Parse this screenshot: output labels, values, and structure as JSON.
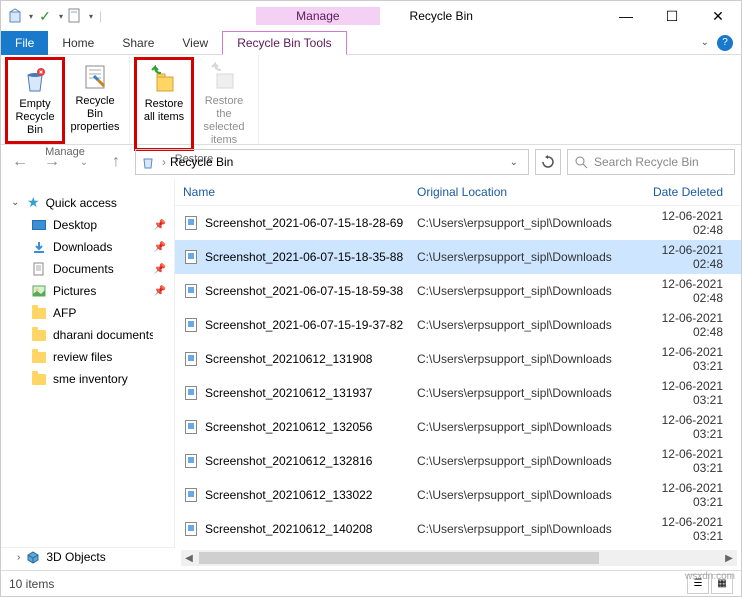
{
  "window": {
    "title": "Recycle Bin",
    "context_tab_group": "Manage",
    "context_tab": "Recycle Bin Tools"
  },
  "tabs": {
    "file": "File",
    "home": "Home",
    "share": "Share",
    "view": "View"
  },
  "ribbon": {
    "empty": "Empty Recycle Bin",
    "props": "Recycle Bin properties",
    "restore_all": "Restore all items",
    "restore_sel": "Restore the selected items",
    "group_manage": "Manage",
    "group_restore": "Restore"
  },
  "address": {
    "location": "Recycle Bin",
    "search_placeholder": "Search Recycle Bin"
  },
  "nav": {
    "quick_access": "Quick access",
    "desktop": "Desktop",
    "downloads": "Downloads",
    "documents": "Documents",
    "pictures": "Pictures",
    "afp": "AFP",
    "dharani": "dharani documents",
    "review": "review files",
    "sme": "sme inventory",
    "obj3d": "3D Objects"
  },
  "columns": {
    "name": "Name",
    "location": "Original Location",
    "date": "Date Deleted"
  },
  "files": [
    {
      "name": "Screenshot_2021-06-07-15-18-28-69",
      "loc": "C:\\Users\\erpsupport_sipl\\Downloads",
      "date": "12-06-2021 02:48"
    },
    {
      "name": "Screenshot_2021-06-07-15-18-35-88",
      "loc": "C:\\Users\\erpsupport_sipl\\Downloads",
      "date": "12-06-2021 02:48"
    },
    {
      "name": "Screenshot_2021-06-07-15-18-59-38",
      "loc": "C:\\Users\\erpsupport_sipl\\Downloads",
      "date": "12-06-2021 02:48"
    },
    {
      "name": "Screenshot_2021-06-07-15-19-37-82",
      "loc": "C:\\Users\\erpsupport_sipl\\Downloads",
      "date": "12-06-2021 02:48"
    },
    {
      "name": "Screenshot_20210612_131908",
      "loc": "C:\\Users\\erpsupport_sipl\\Downloads",
      "date": "12-06-2021 03:21"
    },
    {
      "name": "Screenshot_20210612_131937",
      "loc": "C:\\Users\\erpsupport_sipl\\Downloads",
      "date": "12-06-2021 03:21"
    },
    {
      "name": "Screenshot_20210612_132056",
      "loc": "C:\\Users\\erpsupport_sipl\\Downloads",
      "date": "12-06-2021 03:21"
    },
    {
      "name": "Screenshot_20210612_132816",
      "loc": "C:\\Users\\erpsupport_sipl\\Downloads",
      "date": "12-06-2021 03:21"
    },
    {
      "name": "Screenshot_20210612_133022",
      "loc": "C:\\Users\\erpsupport_sipl\\Downloads",
      "date": "12-06-2021 03:21"
    },
    {
      "name": "Screenshot_20210612_140208",
      "loc": "C:\\Users\\erpsupport_sipl\\Downloads",
      "date": "12-06-2021 03:21"
    }
  ],
  "status": {
    "count": "10 items"
  },
  "watermark": "wsxdn.com"
}
